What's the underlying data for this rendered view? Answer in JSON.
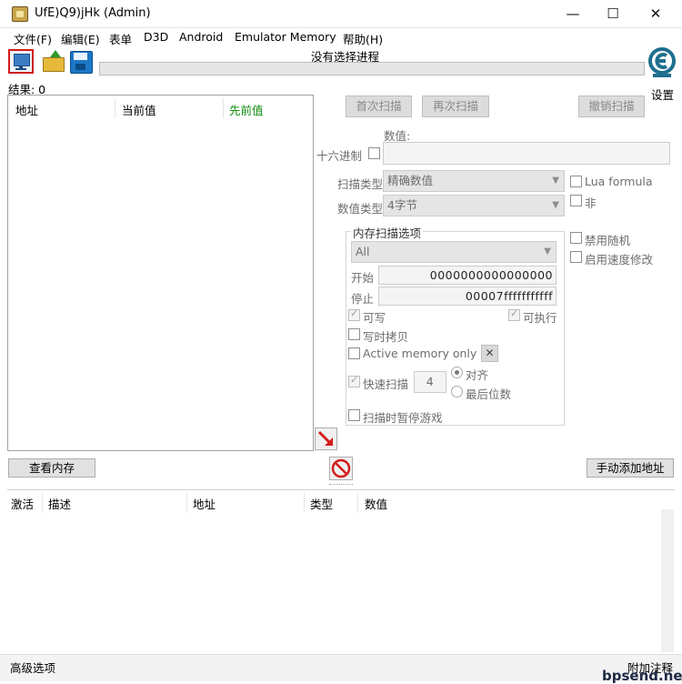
{
  "window": {
    "title": "UfE)Q9)jHk (Admin)",
    "minimize": "—",
    "maximize": "☐",
    "close": "✕"
  },
  "menu": [
    "文件(F)",
    "编辑(E)",
    "表单",
    "D3D",
    "Android",
    "Emulator Memory",
    "帮助(H)"
  ],
  "toolbar": {
    "process_label": "没有选择进程",
    "settings_label": "设置",
    "results_label": "结果: 0"
  },
  "scan_list": {
    "columns": [
      "地址",
      "当前值",
      "先前值"
    ],
    "previous_color": "#0a8a0a"
  },
  "scan_buttons": {
    "first_scan": "首次扫描",
    "next_scan": "再次扫描",
    "undo_scan": "撤销扫描"
  },
  "value": {
    "label": "数值:",
    "hex_label": "十六进制",
    "input_value": ""
  },
  "scan_type": {
    "label": "扫描类型",
    "selected": "精确数值"
  },
  "value_type": {
    "label": "数值类型",
    "selected": "4字节"
  },
  "options_right": {
    "lua_formula": "Lua formula",
    "not": "非",
    "disable_random": "禁用随机",
    "enable_speedhack": "启用速度修改"
  },
  "memory_options": {
    "title": "内存扫描选项",
    "region": "All",
    "start_label": "开始",
    "start_value": "0000000000000000",
    "stop_label": "停止",
    "stop_value": "00007fffffffffff",
    "writable": "可写",
    "executable": "可执行",
    "copy_on_write": "写时拷贝",
    "active_memory_only": "Active memory only",
    "fast_scan": "快速扫描",
    "fast_scan_value": "4",
    "alignment": "对齐",
    "last_digits": "最后位数",
    "pause_game": "扫描时暂停游戏"
  },
  "actions": {
    "view_memory": "查看内存",
    "add_address_manually": "手动添加地址"
  },
  "address_list": {
    "columns": [
      "激活",
      "描述",
      "地址",
      "类型",
      "数值"
    ]
  },
  "status": {
    "advanced_options": "高级选项",
    "table_extras": "附加注释",
    "watermark": "bpsend.net"
  },
  "colors": {
    "process_highlight": "#d21a1a",
    "arrow_red": "#d21a1a"
  }
}
